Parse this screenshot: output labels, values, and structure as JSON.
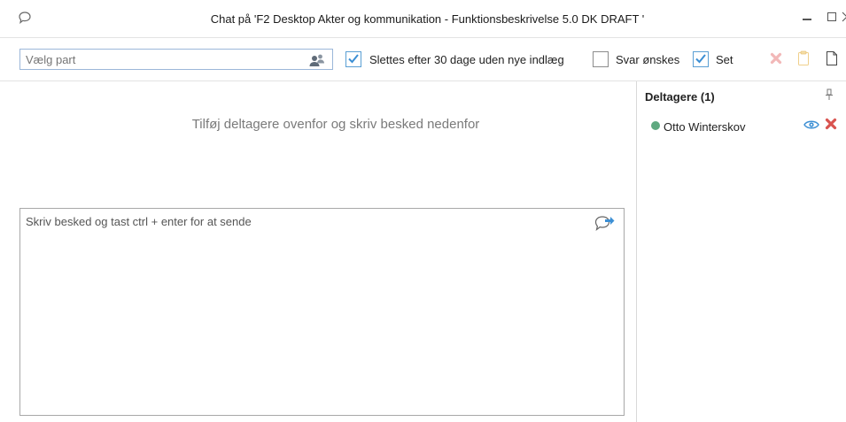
{
  "window": {
    "title": "Chat på 'F2 Desktop Akter og kommunikation - Funktionsbeskrivelse 5.0 DK DRAFT '",
    "icon": "chat-bubble-icon",
    "controls": [
      "minimize-icon",
      "maximize-icon",
      "close-icon"
    ]
  },
  "toolbar": {
    "party": {
      "placeholder": "Vælg part",
      "value": "",
      "icon": "people-icon"
    },
    "checkboxes": [
      {
        "label": "Slettes efter 30 dage uden nye indlæg",
        "checked": true
      },
      {
        "label": "Svar ønskes",
        "checked": false
      },
      {
        "label": "Set",
        "checked": true
      }
    ],
    "actions": [
      {
        "icon": "delete-x-icon",
        "enabled": false
      },
      {
        "icon": "clipboard-icon",
        "enabled": false
      },
      {
        "icon": "new-document-icon",
        "enabled": true
      }
    ]
  },
  "main": {
    "hint": "Tilføj deltagere ovenfor og skriv besked nedenfor",
    "message": {
      "placeholder": "Skriv besked og tast ctrl + enter for at sende",
      "value": "",
      "send_icon": "send-chat-icon"
    }
  },
  "participants": {
    "header": "Deltagere (1)",
    "pin_icon": "pin-icon",
    "items": [
      {
        "name": "Otto Winterskov",
        "status_color": "#5fa980",
        "icons": [
          "eye-icon",
          "remove-icon"
        ]
      }
    ]
  },
  "colors": {
    "accent": "#5a9fd4",
    "delete": "#d9534f",
    "delete_disabled": "#f2b8b8",
    "clipboard_disabled": "#f5dfa8"
  }
}
